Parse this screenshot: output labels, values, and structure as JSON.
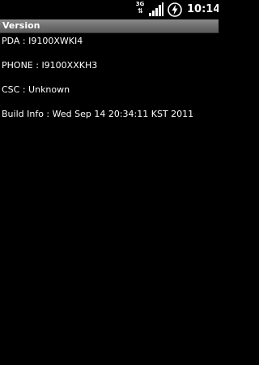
{
  "status_bar": {
    "network_type": "3G",
    "network_arrows": "⇅",
    "signal_icon": "signal-strength-icon",
    "battery_icon": "battery-charging-icon",
    "time": "10:14"
  },
  "title_bar": {
    "title": "Version"
  },
  "info": {
    "pda": "PDA : I9100XWKI4",
    "phone": "PHONE : I9100XXKH3",
    "csc": "CSC : Unknown",
    "build": "Build Info : Wed Sep 14 20:34:11 KST 2011"
  },
  "colors": {
    "background": "#000000",
    "text": "#ffffff",
    "title_bar": "#6f6f6f"
  }
}
